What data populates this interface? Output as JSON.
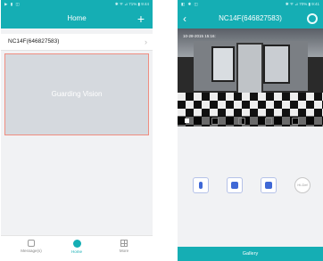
{
  "colors": {
    "teal": "#15aeb4",
    "accent_border": "#f08d80",
    "icon_blue": "#3f68d6"
  },
  "left": {
    "status": {
      "left": "▶ ▮ ◫",
      "right": "✱ ᯤ ⊿ 71% ▮ 9:44"
    },
    "title": "Home",
    "add_icon": "plus-icon",
    "device": {
      "name": "NC14F(646827583)"
    },
    "video_label": "Guarding Vision",
    "tabs": [
      {
        "label": "Message(s)",
        "icon": "message-icon"
      },
      {
        "label": "Home",
        "icon": "home-icon"
      },
      {
        "label": "More",
        "icon": "more-icon"
      }
    ]
  },
  "right": {
    "status": {
      "left": "◧ ✱ ◫",
      "right": "✱ ᯤ ⊿ 70% ▮ 9:41"
    },
    "title": "NC14F(646827583)",
    "timestamp": "10-28-2015 15:16:",
    "actions": [
      {
        "name": "mic",
        "icon": "microphone-icon"
      },
      {
        "name": "record",
        "icon": "record-icon"
      },
      {
        "name": "camera",
        "icon": "video-camera-icon"
      }
    ],
    "hd_label": "Hi-Def",
    "gallery_label": "Gallery"
  }
}
